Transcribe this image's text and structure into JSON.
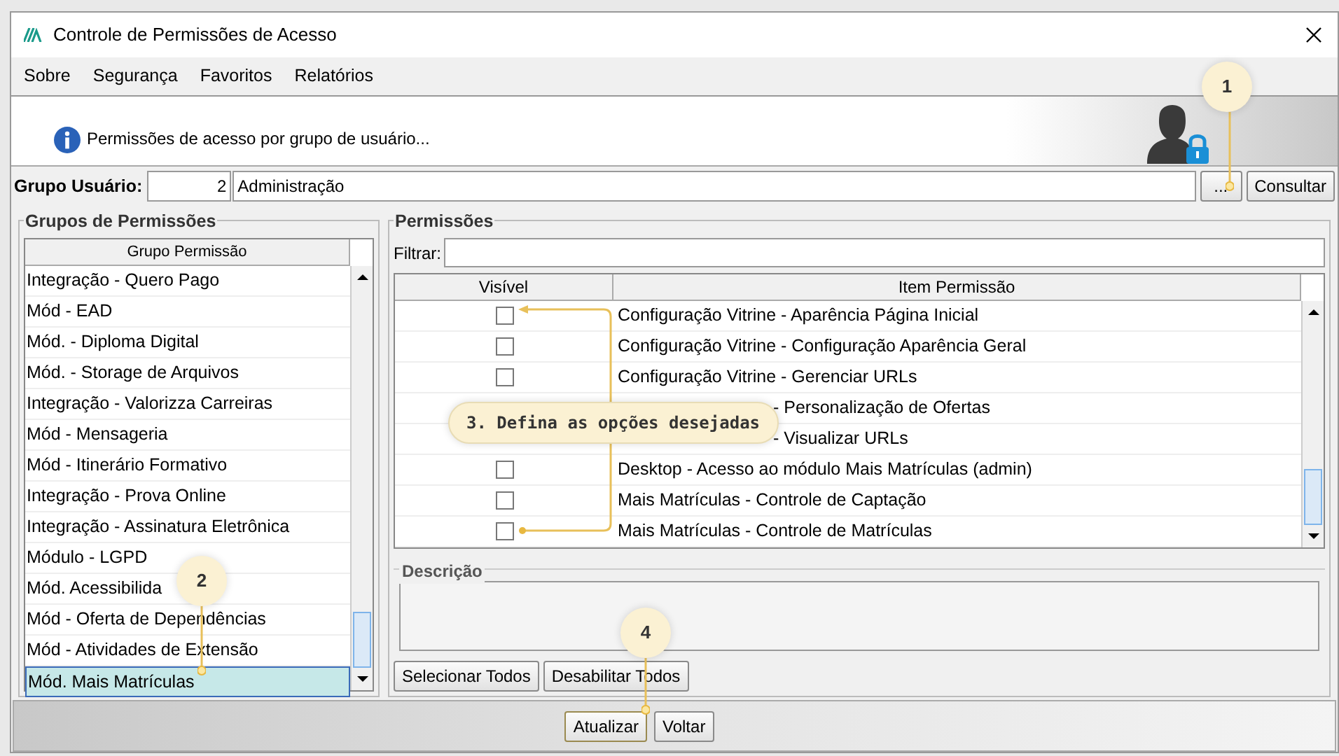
{
  "window": {
    "title": "Controle de Permissões de Acesso"
  },
  "menu": [
    {
      "label": "Sobre"
    },
    {
      "label": "Segurança"
    },
    {
      "label": "Favoritos"
    },
    {
      "label": "Relatórios"
    }
  ],
  "header": {
    "message": "Permissões de acesso por grupo de usuário..."
  },
  "group_user": {
    "label": "Grupo Usuário:",
    "code": "2",
    "name": "Administração",
    "lookup_button": "...",
    "search_button": "Consultar"
  },
  "groups": {
    "title": "Grupos de Permissões",
    "column": "Grupo Permissão",
    "rows": [
      {
        "label": "Integração - Quero Pago",
        "selected": false
      },
      {
        "label": "Mód - EAD",
        "selected": false
      },
      {
        "label": "Mód. - Diploma Digital",
        "selected": false
      },
      {
        "label": "Mód. - Storage de Arquivos",
        "selected": false
      },
      {
        "label": "Integração - Valorizza Carreiras",
        "selected": false
      },
      {
        "label": "Mód - Mensageria",
        "selected": false
      },
      {
        "label": "Mód - Itinerário Formativo",
        "selected": false
      },
      {
        "label": "Integração - Prova Online",
        "selected": false
      },
      {
        "label": "Integração - Assinatura Eletrônica",
        "selected": false
      },
      {
        "label": "Módulo - LGPD",
        "selected": false
      },
      {
        "label": "Mód. Acessibilida",
        "selected": false
      },
      {
        "label": "Mód - Oferta de Dependências",
        "selected": false
      },
      {
        "label": "Mód - Atividades de Extensão",
        "selected": false
      },
      {
        "label": "Mód. Mais Matrículas",
        "selected": true
      }
    ]
  },
  "permissions": {
    "title": "Permissões",
    "filter_label": "Filtrar:",
    "columns": [
      "Visível",
      "Item Permissão"
    ],
    "rows": [
      {
        "item": "Configuração Vitrine - Aparência Página Inicial",
        "checked": false,
        "covered": false
      },
      {
        "item": "Configuração Vitrine - Configuração Aparência Geral",
        "checked": false,
        "covered": false
      },
      {
        "item": "Configuração Vitrine - Gerenciar URLs",
        "checked": false,
        "covered": false
      },
      {
        "item": "- Personalização de Ofertas",
        "covered": true
      },
      {
        "item": "- Visualizar URLs",
        "covered": true
      },
      {
        "item": "Desktop - Acesso ao módulo Mais Matrículas (admin)",
        "checked": false,
        "covered": false
      },
      {
        "item": "Mais Matrículas - Controle de Captação",
        "checked": false,
        "covered": false
      },
      {
        "item": "Mais Matrículas - Controle de Matrículas",
        "checked": false,
        "covered": false
      }
    ],
    "description_label": "Descrição",
    "buttons": [
      "Selecionar Todos",
      "Desabilitar Todos"
    ]
  },
  "footer_buttons": [
    {
      "label": "Atualizar",
      "highlighted": true
    },
    {
      "label": "Voltar",
      "highlighted": false
    }
  ],
  "annotations": [
    {
      "kind": "circle",
      "label": "1"
    },
    {
      "kind": "circle",
      "label": "2"
    },
    {
      "kind": "bubble",
      "label": "3. Defina as opções desejadas"
    },
    {
      "kind": "circle",
      "label": "4"
    }
  ]
}
